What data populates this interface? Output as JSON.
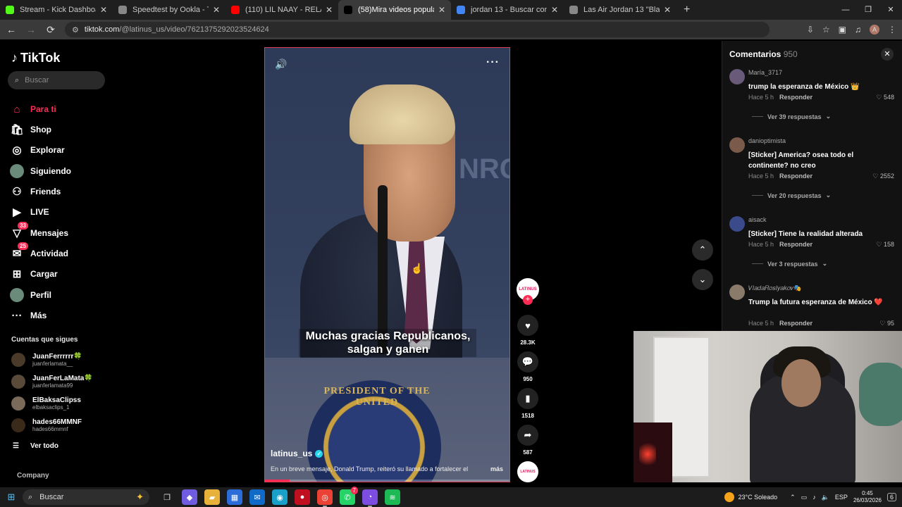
{
  "browser": {
    "tabs": [
      {
        "title": "Stream - Kick Dashboard",
        "favicon_color": "#53fc18",
        "active": false
      },
      {
        "title": "Speedtest by Ookla - The Global",
        "favicon_color": "#888888",
        "active": false
      },
      {
        "title": "(110) LIL NAAY - RELACIONADO",
        "favicon_color": "#ff0000",
        "active": false
      },
      {
        "title": "(58)Mira videos populares",
        "favicon_color": "#000000",
        "active": true
      },
      {
        "title": "jordan 13 - Buscar con Google",
        "favicon_color": "#4285f4",
        "active": false
      },
      {
        "title": "Las Air Jordan 13 \"Black Flint\" s",
        "favicon_color": "#888888",
        "active": false
      }
    ],
    "url_domain": "tiktok.com",
    "url_path": "/@latinus_us/video/7621375292023524624",
    "profile_initial": "A"
  },
  "sidebar": {
    "logo": "TikTok",
    "search_placeholder": "Buscar",
    "nav": [
      {
        "label": "Para ti",
        "icon": "home-icon",
        "active": true
      },
      {
        "label": "Shop",
        "icon": "shop-icon"
      },
      {
        "label": "Explorar",
        "icon": "compass-icon"
      },
      {
        "label": "Siguiendo",
        "icon": "avatar-icon"
      },
      {
        "label": "Friends",
        "icon": "friends-icon"
      },
      {
        "label": "LIVE",
        "icon": "live-icon"
      },
      {
        "label": "Mensajes",
        "icon": "messages-icon",
        "badge": "33"
      },
      {
        "label": "Actividad",
        "icon": "activity-icon",
        "badge": "25"
      },
      {
        "label": "Cargar",
        "icon": "upload-icon"
      },
      {
        "label": "Perfil",
        "icon": "profile-icon"
      },
      {
        "label": "Más",
        "icon": "more-icon"
      }
    ],
    "following_title": "Cuentas que sigues",
    "following": [
      {
        "name": "JuanFerrrrrr🍀",
        "handle": "juanferlamata__"
      },
      {
        "name": "JuanFerLaMata🍀",
        "handle": "juanferlamata99"
      },
      {
        "name": "ElBaksaClipss",
        "handle": "elbaksaclips_1"
      },
      {
        "name": "hades66MMNF",
        "handle": "hades66mmnf"
      }
    ],
    "see_all": "Ver todo",
    "company": "Company"
  },
  "video": {
    "caption_line1": "Muchas gracias Republicanos,",
    "caption_line2": "salgan y ganen",
    "background_text": "NRC",
    "seal_text": "PRESIDENT OF THE UNITED",
    "author": "latinus_us",
    "description": "En un breve mensaje, Donald Trump, reiteró su llamado a fortalecer el",
    "more_label": "más",
    "progress_fraction": 0.1
  },
  "actions": {
    "avatar_label": "LATINUS",
    "likes": "28.3K",
    "comments": "950",
    "saves": "1518",
    "shares": "587"
  },
  "comments_panel": {
    "title": "Comentarios",
    "count": "950",
    "items": [
      {
        "user": "María_3717",
        "text": "trump la esperanza de México 👑",
        "time": "Hace 5 h",
        "reply": "Responder",
        "likes": "548",
        "replies": "Ver 39 respuestas",
        "color": "#6a5a7a"
      },
      {
        "user": "danioptimista",
        "text": "[Sticker] America? osea todo el continente? no creo",
        "time": "Hace 5 h",
        "reply": "Responder",
        "likes": "2552",
        "replies": "Ver 20 respuestas",
        "color": "#7a5a4a"
      },
      {
        "user": "aisack",
        "text": "[Sticker] Tiene la realidad alterada",
        "time": "Hace 5 h",
        "reply": "Responder",
        "likes": "158",
        "replies": "Ver 3 respuestas",
        "color": "#3a4a8a"
      },
      {
        "user": "𝑉𝑙𝑎𝑑𝑎𝑅𝑜𝑠𝑙𝑦𝑎𝑘𝑜𝑣🎭",
        "text": "Trump la futura esperanza de México ❤️",
        "time": "Hace 5 h",
        "reply": "Responder",
        "likes": "95",
        "replies": "",
        "color": "#8a7a6a"
      }
    ]
  },
  "taskbar": {
    "search_label": "Buscar",
    "weather": "23°C  Soleado",
    "lang": "ESP",
    "time": "0:45",
    "date": "26/03/2026",
    "notif_count": "6",
    "whatsapp_badge": "7"
  }
}
